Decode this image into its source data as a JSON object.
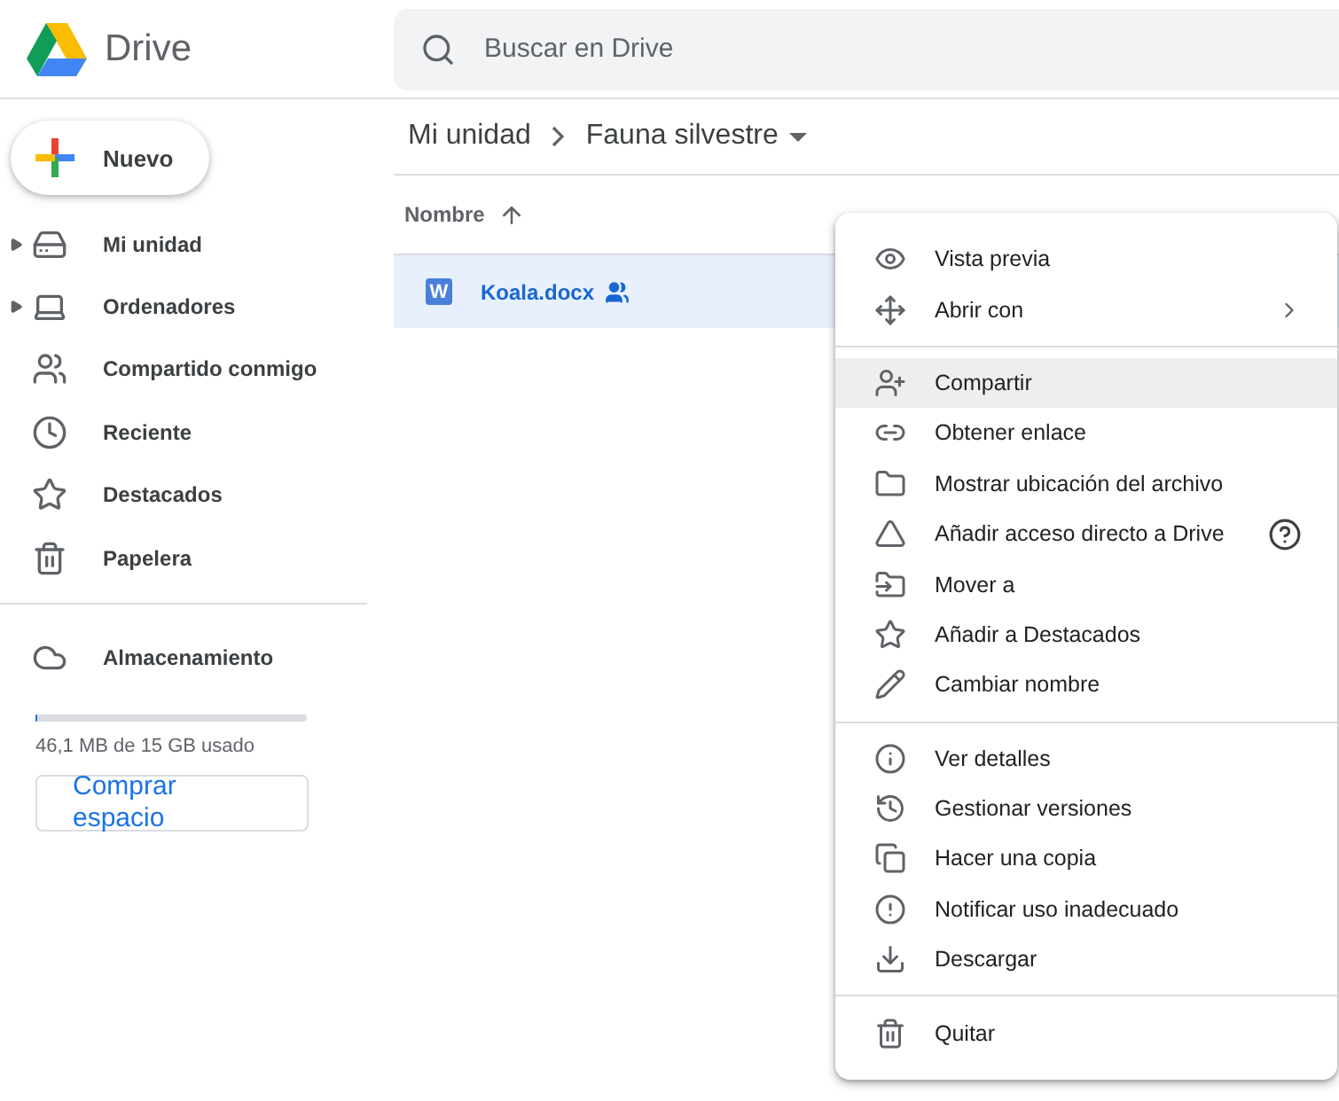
{
  "app": {
    "name": "Drive"
  },
  "search": {
    "placeholder": "Buscar en Drive"
  },
  "new_button": {
    "label": "Nuevo"
  },
  "sidebar": {
    "items": [
      {
        "label": "Mi unidad",
        "expandable": true
      },
      {
        "label": "Ordenadores",
        "expandable": true
      },
      {
        "label": "Compartido conmigo",
        "expandable": false
      },
      {
        "label": "Reciente",
        "expandable": false
      },
      {
        "label": "Destacados",
        "expandable": false
      },
      {
        "label": "Papelera",
        "expandable": false
      }
    ],
    "storage": {
      "label": "Almacenamiento",
      "level": 0.003,
      "usage": "46,1 MB de 15 GB usado",
      "button": "Comprar espacio"
    }
  },
  "breadcrumb": [
    {
      "label": "Mi unidad"
    },
    {
      "label": "Fauna silvestre"
    }
  ],
  "table": {
    "columns": [
      {
        "label": "Nombre"
      }
    ],
    "rows": [
      {
        "type_badge": "W",
        "name": "Koala.docx",
        "selected": true,
        "shared": true
      }
    ]
  },
  "context_menu": {
    "groups": [
      [
        {
          "label": "Vista previa",
          "submenu": false,
          "help": false,
          "highlighted": false
        },
        {
          "label": "Abrir con",
          "submenu": true,
          "help": false,
          "highlighted": false
        }
      ],
      [
        {
          "label": "Compartir",
          "submenu": false,
          "help": false,
          "highlighted": true
        },
        {
          "label": "Obtener enlace",
          "submenu": false,
          "help": false,
          "highlighted": false
        },
        {
          "label": "Mostrar ubicación del archivo",
          "submenu": false,
          "help": false,
          "highlighted": false
        },
        {
          "label": "Añadir acceso directo a Drive",
          "submenu": false,
          "help": true,
          "highlighted": false
        },
        {
          "label": "Mover a",
          "submenu": false,
          "help": false,
          "highlighted": false
        },
        {
          "label": "Añadir a Destacados",
          "submenu": false,
          "help": false,
          "highlighted": false
        },
        {
          "label": "Cambiar nombre",
          "submenu": false,
          "help": false,
          "highlighted": false
        }
      ],
      [
        {
          "label": "Ver detalles",
          "submenu": false,
          "help": false,
          "highlighted": false
        },
        {
          "label": "Gestionar versiones",
          "submenu": false,
          "help": false,
          "highlighted": false
        },
        {
          "label": "Hacer una copia",
          "submenu": false,
          "help": false,
          "highlighted": false
        },
        {
          "label": "Notificar uso inadecuado",
          "submenu": false,
          "help": false,
          "highlighted": false
        },
        {
          "label": "Descargar",
          "submenu": false,
          "help": false,
          "highlighted": false
        }
      ],
      [
        {
          "label": "Quitar",
          "submenu": false,
          "help": false,
          "highlighted": false
        }
      ]
    ]
  }
}
